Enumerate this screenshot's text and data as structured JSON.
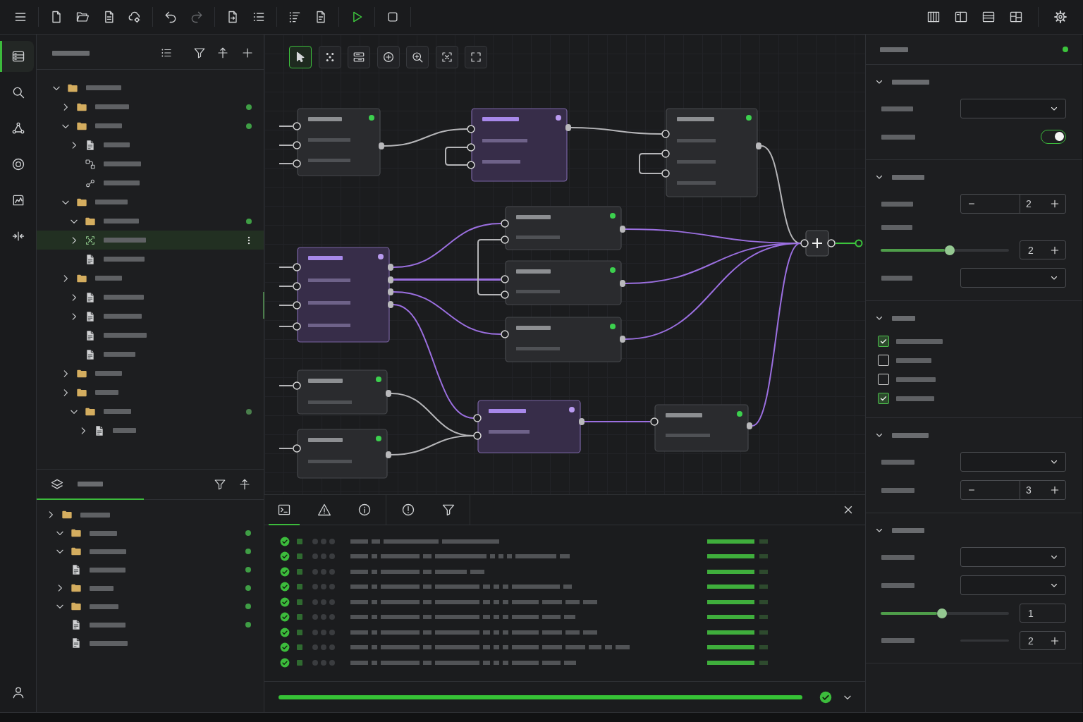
{
  "toolbar": {
    "buttons": [
      {
        "disabled": false
      },
      {
        "disabled": false
      },
      {
        "disabled": false
      },
      {
        "disabled": false
      },
      {
        "disabled": false
      },
      {
        "disabled": false
      },
      {
        "disabled": true
      },
      {
        "disabled": false
      },
      {
        "disabled": false
      },
      {
        "disabled": false
      },
      {
        "disabled": false
      },
      {
        "disabled": false
      },
      {
        "disabled": false
      },
      {
        "disabled": false
      },
      {
        "disabled": false
      },
      {
        "disabled": false
      },
      {
        "disabled": false
      },
      {
        "disabled": false
      }
    ]
  },
  "activity_bar": {
    "items": [
      {
        "selected": true
      },
      {
        "selected": false
      },
      {
        "selected": false
      },
      {
        "selected": false
      },
      {
        "selected": false
      },
      {
        "selected": false
      }
    ]
  },
  "explorer": {
    "tree": [
      {
        "kind": "folder",
        "expanded": true,
        "selected": false,
        "children": [
          {
            "kind": "folder",
            "expanded": false,
            "selected": false,
            "color": "#3f9e45"
          },
          {
            "kind": "folder",
            "expanded": true,
            "selected": false,
            "color": "#3f9e45",
            "children": [
              {
                "kind": "file",
                "expanded": false,
                "selected": false
              },
              {
                "kind": "graph",
                "selected": false
              },
              {
                "kind": "link",
                "selected": false
              }
            ]
          },
          {
            "kind": "folder",
            "expanded": true,
            "selected": false,
            "children": [
              {
                "kind": "folder",
                "expanded": true,
                "selected": false,
                "color": "#3f9e45"
              },
              {
                "kind": "diagram",
                "expanded": false,
                "selected": true
              },
              {
                "kind": "file",
                "selected": false
              }
            ]
          },
          {
            "kind": "folder",
            "expanded": false,
            "selected": false,
            "children": [
              {
                "kind": "file",
                "expanded": false,
                "selected": false
              },
              {
                "kind": "file",
                "expanded": false,
                "selected": false
              },
              {
                "kind": "file",
                "selected": false
              },
              {
                "kind": "file",
                "selected": false
              }
            ]
          },
          {
            "kind": "folder",
            "expanded": false,
            "selected": false
          },
          {
            "kind": "folder",
            "expanded": false,
            "selected": false,
            "children": [
              {
                "kind": "folder",
                "expanded": true,
                "selected": false,
                "color": "#4a7f4c",
                "children": [
                  {
                    "kind": "file",
                    "expanded": false,
                    "selected": false
                  }
                ]
              }
            ]
          }
        ]
      }
    ]
  },
  "layers": {
    "tab": {
      "selected": true
    },
    "tree": [
      {
        "kind": "folder",
        "expanded": false,
        "selected": false,
        "children": [
          {
            "kind": "folder",
            "expanded": true,
            "selected": false,
            "color": "#3f9e45"
          },
          {
            "kind": "folder",
            "expanded": true,
            "selected": false,
            "color": "#3f9e45"
          },
          {
            "kind": "file",
            "selected": false,
            "color": "#3f9e45"
          },
          {
            "kind": "folder",
            "expanded": false,
            "selected": false,
            "color": "#3f9e45"
          },
          {
            "kind": "folder",
            "expanded": true,
            "selected": false,
            "color": "#3f9e45"
          },
          {
            "kind": "file",
            "selected": false,
            "color": "#3f9e45"
          },
          {
            "kind": "file",
            "selected": false
          }
        ]
      }
    ]
  },
  "canvas": {
    "tools": [
      {
        "selected": true
      },
      {
        "selected": false
      },
      {
        "selected": false
      },
      {
        "selected": false
      },
      {
        "selected": false
      },
      {
        "selected": false
      },
      {
        "selected": false
      }
    ],
    "nodes": [
      {
        "kind": "standard",
        "color": "#3cd04e"
      },
      {
        "kind": "accent",
        "color": "#b99af0"
      },
      {
        "kind": "standard",
        "color": "#3cd04e"
      },
      {
        "kind": "standard",
        "color": "#3cd04e"
      },
      {
        "kind": "standard",
        "color": "#3cd04e"
      },
      {
        "kind": "standard",
        "color": "#3cd04e"
      },
      {
        "kind": "accent",
        "color": "#b99af0"
      },
      {
        "kind": "standard",
        "color": "#3cd04e"
      },
      {
        "kind": "standard",
        "color": "#3cd04e"
      },
      {
        "kind": "accent",
        "color": "#b99af0"
      },
      {
        "kind": "standard",
        "color": "#3cd04e"
      },
      {
        "kind": "junction"
      }
    ],
    "connections": [
      {
        "color": "#b5b5b8"
      },
      {
        "color": "#b5b5b8"
      },
      {
        "color": "#b5b5b8"
      },
      {
        "color": "#b5b5b8"
      },
      {
        "color": "#b5b5b8"
      },
      {
        "color": "#9b6fe0"
      },
      {
        "color": "#9b6fe0"
      },
      {
        "color": "#9b6fe0"
      },
      {
        "color": "#9b6fe0"
      },
      {
        "color": "#b5b5b8"
      },
      {
        "color": "#9b6fe0"
      },
      {
        "color": "#9b6fe0"
      },
      {
        "color": "#9b6fe0"
      },
      {
        "color": "#b5b5b8"
      },
      {
        "color": "#b5b5b8"
      },
      {
        "color": "#9b6fe0"
      },
      {
        "color": "#9b6fe0"
      },
      {
        "color": "#3cc43c"
      },
      {
        "color": "#b5b5b8"
      },
      {
        "color": "#b5b5b8"
      },
      {
        "color": "#b5b5b8"
      },
      {
        "color": "#b5b5b8"
      },
      {
        "color": "#b5b5b8"
      },
      {
        "color": "#b5b5b8"
      },
      {
        "color": "#b5b5b8"
      },
      {
        "color": "#b5b5b8"
      },
      {
        "color": "#b5b5b8"
      }
    ]
  },
  "inspector": {
    "status": {
      "color": "#3cc43c"
    },
    "sections": [
      {
        "expanded": true,
        "rows": [
          {
            "kind": "select"
          },
          {
            "kind": "toggle",
            "on": true
          }
        ]
      },
      {
        "expanded": true,
        "rows": [
          {
            "kind": "stepper",
            "value": "2"
          },
          {
            "kind": "caption"
          },
          {
            "kind": "slider",
            "labeled": false,
            "level": 0.54,
            "value": "2",
            "increment": true
          },
          {
            "kind": "select"
          }
        ]
      },
      {
        "expanded": true,
        "rows": [
          {
            "kind": "checkbox",
            "checked": true
          },
          {
            "kind": "checkbox",
            "checked": false
          },
          {
            "kind": "checkbox",
            "checked": false
          },
          {
            "kind": "checkbox",
            "checked": true
          }
        ]
      },
      {
        "expanded": true,
        "rows": [
          {
            "kind": "select"
          },
          {
            "kind": "stepper",
            "value": "3"
          }
        ]
      },
      {
        "expanded": true,
        "rows": [
          {
            "kind": "select"
          },
          {
            "kind": "select"
          },
          {
            "kind": "slider",
            "labeled": false,
            "level": 0.48,
            "value": "1",
            "increment": false
          },
          {
            "kind": "slider",
            "labeled": true,
            "value": "2",
            "increment": true
          }
        ]
      }
    ]
  },
  "console": {
    "tabs": [
      {
        "selected": true
      },
      {
        "selected": false
      },
      {
        "selected": false
      },
      {
        "selected": false
      },
      {
        "selected": false
      }
    ],
    "entries": [
      {
        "passed": true
      },
      {
        "passed": true
      },
      {
        "passed": true
      },
      {
        "passed": true
      },
      {
        "passed": true
      },
      {
        "passed": true
      },
      {
        "passed": true
      },
      {
        "passed": true
      },
      {
        "passed": true
      }
    ],
    "progress": {
      "level": 1,
      "complete": true
    }
  }
}
